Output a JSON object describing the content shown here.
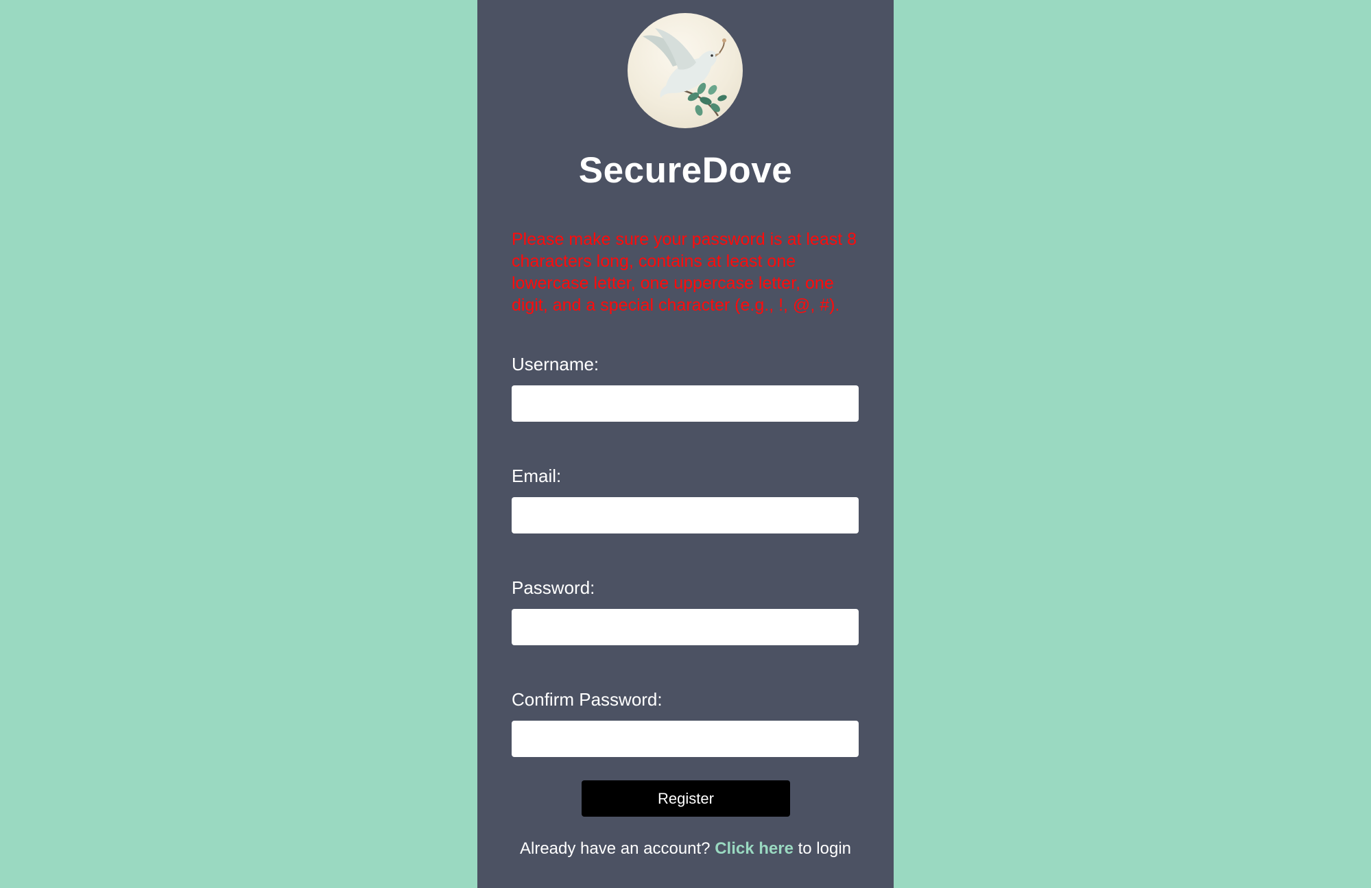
{
  "app": {
    "title": "SecureDove",
    "logo_icon": "dove-with-olive-branch-icon"
  },
  "colors": {
    "background": "#9ad9c1",
    "panel": "#4c5263",
    "warning": "#ff0b0b",
    "link": "#9ad9c1",
    "button": "#000000"
  },
  "form": {
    "warning": "Please make sure your password is at least 8 characters long, contains at least one lowercase letter, one uppercase letter, one digit, and a special character (e.g., !, @, #).",
    "username_label": "Username:",
    "username_value": "",
    "email_label": "Email:",
    "email_value": "",
    "password_label": "Password:",
    "password_value": "",
    "confirm_label": "Confirm Password:",
    "confirm_value": "",
    "register_label": "Register"
  },
  "footer": {
    "prefix": "Already have an account?",
    "link_text": "Click here",
    "suffix": "to login"
  }
}
